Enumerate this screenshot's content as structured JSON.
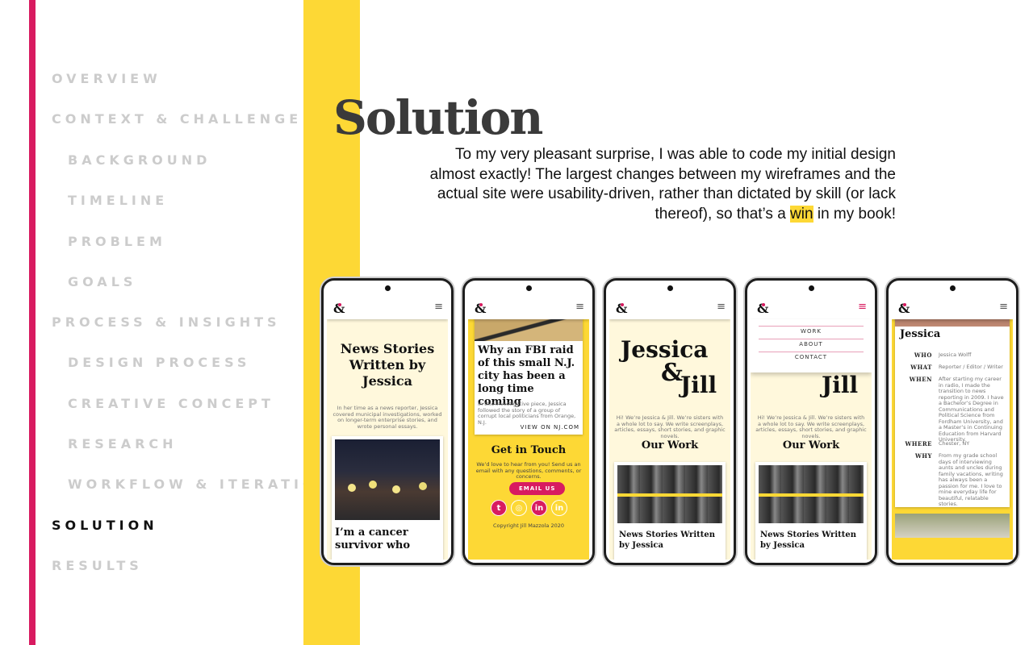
{
  "sidebar": {
    "items": [
      {
        "label": "OVERVIEW"
      },
      {
        "label": "CONTEXT & CHALLENGE"
      },
      {
        "label": "BACKGROUND"
      },
      {
        "label": "TIMELINE"
      },
      {
        "label": "PROBLEM"
      },
      {
        "label": "GOALS"
      },
      {
        "label": "PROCESS & INSIGHTS"
      },
      {
        "label": "DESIGN PROCESS"
      },
      {
        "label": "CREATIVE CONCEPT"
      },
      {
        "label": "RESEARCH"
      },
      {
        "label": "WORKFLOW & ITERATIONS"
      },
      {
        "label": "SOLUTION"
      },
      {
        "label": "RESULTS"
      }
    ],
    "active": "SOLUTION"
  },
  "main": {
    "title": "Solution",
    "paragraph_before": "To my very pleasant surprise, I was able to code my initial design almost exactly! The largest changes between my wireframes and the actual site were usability-driven, rather than dictated by skill (or lack thereof), so that’s a ",
    "paragraph_highlight": "win",
    "paragraph_after": " in my book!"
  },
  "phones": {
    "p1": {
      "title": "News Stories Written by Jessica",
      "intro": "In her time as a news reporter, Jessica covered municipal investigations, worked on longer-term enterprise stories, and wrote personal essays.",
      "story_title": "I’m a cancer survivor who"
    },
    "p2": {
      "story_title": "Why an FBI raid of this small N.J. city has been a long time coming",
      "story_text": "In this investigative piece, Jessica followed the story of a group of corrupt local politicians from Orange, N.J.",
      "link": "VIEW ON NJ.COM",
      "contact_title": "Get in Touch",
      "contact_text": "We’d love to hear from you! Send us an email with any questions, comments, or concerns.",
      "email_button": "EMAIL US",
      "copyright": "Copyright Jill Mazzola 2020"
    },
    "p3": {
      "brand_line1": "Jessica",
      "brand_amp": "&",
      "brand_line2": "Jill",
      "intro": "Hi! We’re Jessica & Jill. We’re sisters with a whole lot to say. We write screenplays, articles, essays, short stories, and graphic novels.",
      "section": "Our Work",
      "card_title": "News Stories Written by Jessica"
    },
    "p4": {
      "menu": [
        "WORK",
        "ABOUT",
        "CONTACT"
      ],
      "brand_partial": "Jill",
      "intro": "Hi! We’re Jessica & Jill. We’re sisters with a whole lot to say. We write screenplays, articles, essays, short stories, and graphic novels.",
      "section": "Our Work",
      "card_title": "News Stories Written by Jessica"
    },
    "p5": {
      "name": "Jessica",
      "rows": [
        {
          "k": "WHO",
          "v": "Jessica Wolff"
        },
        {
          "k": "WHAT",
          "v": "Reporter / Editor / Writer"
        },
        {
          "k": "WHEN",
          "v": "After starting my career in radio, I made the transition to news reporting in 2009. I have a Bachelor’s Degree in Communications and Political Science from Fordham University, and a Master’s in Continuing Education from Harvard University."
        },
        {
          "k": "WHERE",
          "v": "Chester, NY"
        },
        {
          "k": "WHY",
          "v": "From my grade school days of interviewing aunts and uncles during family vacations, writing has always been a passion for me. I love to mine everyday life for beautiful, relatable stories."
        }
      ]
    },
    "logo_glyph": "&",
    "menu_icon": "≡"
  },
  "colors": {
    "accent_pink": "#d81b60",
    "accent_yellow": "#fdd835"
  }
}
